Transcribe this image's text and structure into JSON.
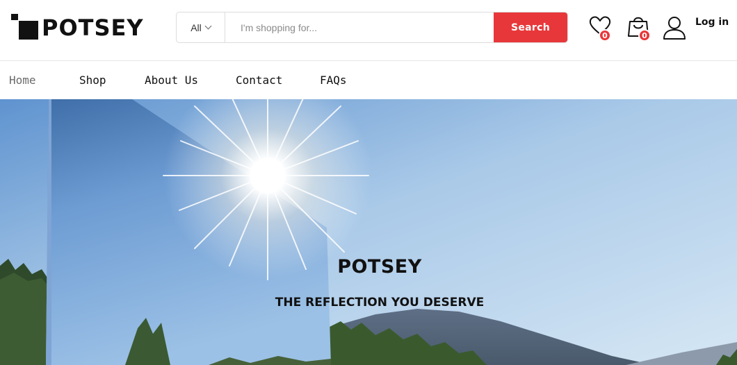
{
  "brand": {
    "name": "POTSEY"
  },
  "search": {
    "category": "All",
    "placeholder": "I'm shopping for...",
    "value": "",
    "button_label": "Search"
  },
  "header": {
    "wishlist_count": "0",
    "cart_count": "0",
    "login_label": "Log in",
    "icons": [
      "heart-icon",
      "shopping-bag-icon",
      "user-icon",
      "chevron-down-icon"
    ]
  },
  "nav": {
    "items": [
      {
        "label": "Home",
        "active": true
      },
      {
        "label": "Shop",
        "active": false
      },
      {
        "label": "About Us",
        "active": false
      },
      {
        "label": "Contact",
        "active": false
      },
      {
        "label": "FAQs",
        "active": false
      }
    ]
  },
  "hero": {
    "title": "POTSEY",
    "subtitle": "THE REFLECTION YOU DESERVE"
  },
  "colors": {
    "accent": "#e8373a",
    "text": "#111111",
    "nav_active": "#6b6b6b",
    "sky_top": "#6fa0d6",
    "sky_bottom": "#cfe2f2"
  }
}
